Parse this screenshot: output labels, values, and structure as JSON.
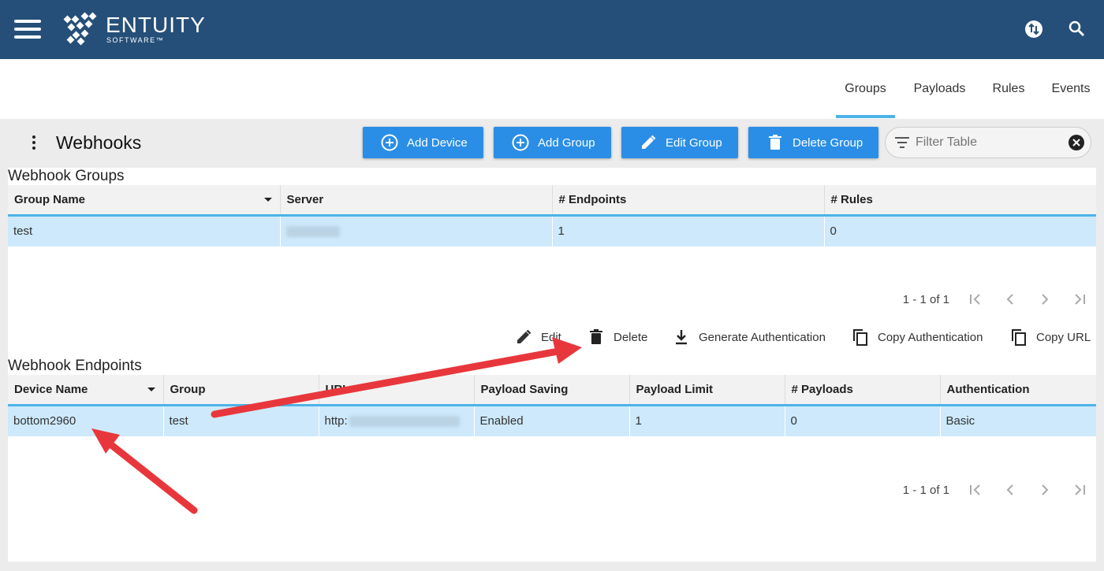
{
  "brand": {
    "name": "ENTUITY",
    "sub": "SOFTWARE™"
  },
  "topbar_icons": [
    "transfer-icon",
    "search-icon"
  ],
  "nav": {
    "tabs": [
      {
        "label": "Groups",
        "active": true
      },
      {
        "label": "Payloads",
        "active": false
      },
      {
        "label": "Rules",
        "active": false
      },
      {
        "label": "Events",
        "active": false
      }
    ]
  },
  "page": {
    "title": "Webhooks"
  },
  "toolbar": {
    "add_device": "Add Device",
    "add_group": "Add Group",
    "edit_group": "Edit Group",
    "delete_group": "Delete Group",
    "filter_placeholder": "Filter Table"
  },
  "groups": {
    "title": "Webhook Groups",
    "columns": [
      "Group Name",
      "Server",
      "# Endpoints",
      "# Rules"
    ],
    "rows": [
      {
        "name": "test",
        "server": "",
        "endpoints": "1",
        "rules": "0"
      }
    ],
    "pager": "1 - 1 of 1"
  },
  "actions": {
    "edit": "Edit",
    "delete": "Delete",
    "generate": "Generate Authentication",
    "copy_auth": "Copy Authentication",
    "copy_url": "Copy URL"
  },
  "endpoints": {
    "title": "Webhook Endpoints",
    "columns": [
      "Device Name",
      "Group",
      "URL",
      "Payload Saving",
      "Payload Limit",
      "# Payloads",
      "Authentication"
    ],
    "rows": [
      {
        "device": "bottom2960",
        "group": "test",
        "url": "http:",
        "saving": "Enabled",
        "limit": "1",
        "payloads": "0",
        "auth": "Basic"
      }
    ],
    "pager": "1 - 1 of 1"
  },
  "colors": {
    "topbar": "#254f78",
    "accent": "#4db3e6",
    "button": "#2a8ee6",
    "selected_row": "#cde9fb",
    "annotation_arrow": "#e8373c"
  }
}
